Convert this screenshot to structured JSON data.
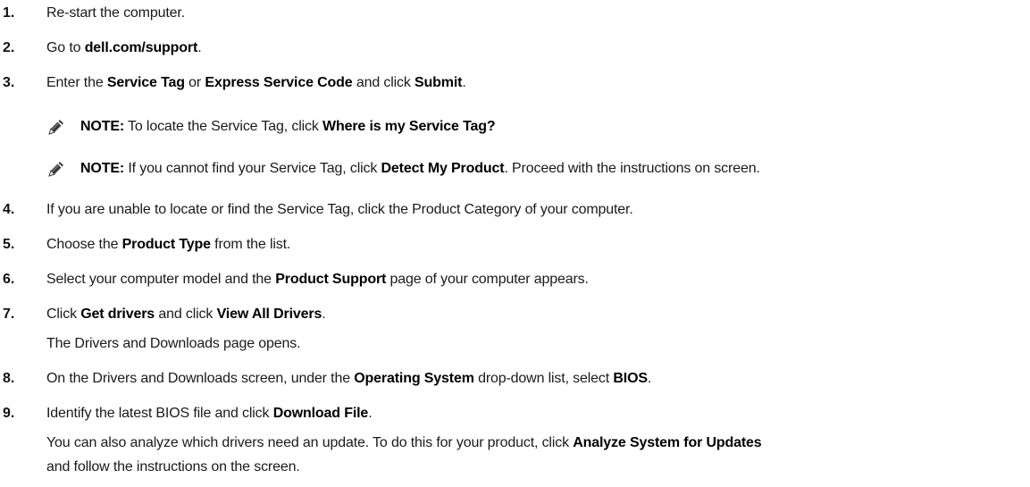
{
  "steps": [
    {
      "num": "1.",
      "parts": [
        "Re-start the computer."
      ]
    },
    {
      "num": "2.",
      "parts": [
        "Go to ",
        "dell.com/support",
        "."
      ]
    },
    {
      "num": "3.",
      "parts": [
        "Enter the ",
        "Service Tag",
        " or ",
        "Express Service Code",
        " and click ",
        "Submit",
        "."
      ]
    },
    {
      "num": "4.",
      "parts": [
        "If you are unable to locate or find the Service Tag, click the Product Category of your computer."
      ]
    },
    {
      "num": "5.",
      "parts": [
        "Choose the ",
        "Product Type",
        " from the list."
      ]
    },
    {
      "num": "6.",
      "parts": [
        "Select your computer model and the ",
        "Product Support",
        " page of your computer appears."
      ]
    },
    {
      "num": "7.",
      "parts": [
        "Click ",
        "Get drivers",
        " and click ",
        "View All Drivers",
        "."
      ]
    },
    {
      "num": "8.",
      "parts": [
        "On the Drivers and Downloads screen, under the ",
        "Operating System",
        " drop-down list, select ",
        "BIOS",
        "."
      ]
    },
    {
      "num": "9.",
      "parts": [
        "Identify the latest BIOS file and click ",
        "Download File",
        "."
      ]
    }
  ],
  "notes": [
    {
      "label": "NOTE:",
      "parts": [
        " To locate the Service Tag, click ",
        "Where is my Service Tag?"
      ]
    },
    {
      "label": "NOTE:",
      "parts": [
        " If you cannot find your Service Tag, click ",
        "Detect My Product",
        ". Proceed with the instructions on screen."
      ]
    }
  ],
  "step7_result": "The Drivers and Downloads page opens.",
  "step9_extra": {
    "line1_parts": [
      "You can also analyze which drivers need an update. To do this for your product, click ",
      "Analyze System for Updates"
    ],
    "line2": "and follow the instructions on the screen."
  },
  "icons": {
    "note": "pencil-note-icon"
  }
}
